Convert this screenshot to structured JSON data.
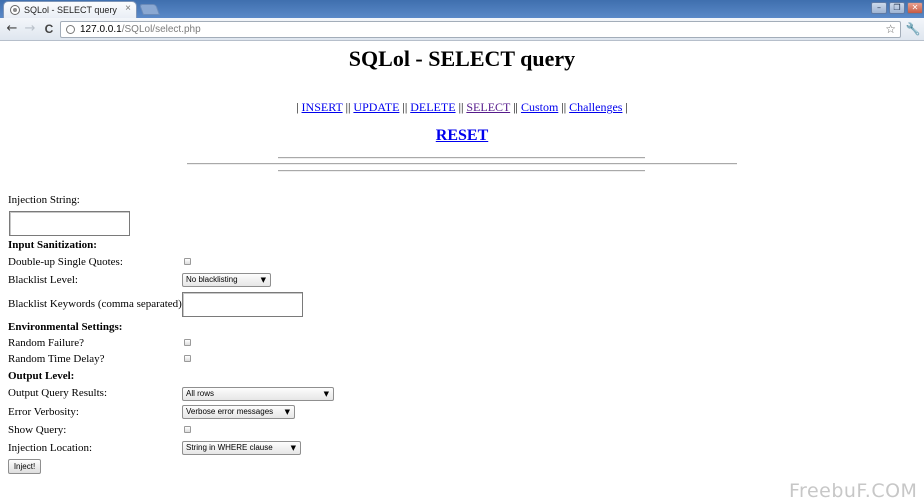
{
  "browser": {
    "tab_title": "SQLol - SELECT query",
    "tab_close_glyph": "×",
    "url_host": "127.0.0.1",
    "url_path": "/SQLol/select.php",
    "back_glyph": "←",
    "forward_glyph": "→",
    "reload_glyph": "C",
    "star_glyph": "☆",
    "wrench_glyph": "🔧",
    "window_controls": {
      "minimize": "–",
      "maximize": "❐",
      "close": "✕"
    }
  },
  "page": {
    "title": "SQLol - SELECT query",
    "nav": {
      "sep_first": "|",
      "sep": "||",
      "sep_last": "|",
      "items": [
        "INSERT",
        "UPDATE",
        "DELETE",
        "SELECT",
        "Custom",
        "Challenges"
      ]
    },
    "reset_label": "RESET"
  },
  "form": {
    "injection_string_label": "Injection String:",
    "injection_string_value": "",
    "input_sanitization_heading": "Input Sanitization:",
    "double_up_quotes_label": "Double-up Single Quotes:",
    "double_up_quotes_checked": false,
    "blacklist_level_label": "Blacklist Level:",
    "blacklist_level_value": "No blacklisting",
    "blacklist_keywords_label": "Blacklist Keywords (comma separated):",
    "blacklist_keywords_value": "",
    "environmental_heading": "Environmental Settings:",
    "random_failure_label": "Random Failure?",
    "random_failure_checked": false,
    "random_delay_label": "Random Time Delay?",
    "random_delay_checked": false,
    "output_level_heading": "Output Level:",
    "output_results_label": "Output Query Results:",
    "output_results_value": "All rows",
    "error_verbosity_label": "Error Verbosity:",
    "error_verbosity_value": "Verbose error messages",
    "show_query_label": "Show Query:",
    "show_query_checked": false,
    "injection_location_label": "Injection Location:",
    "injection_location_value": "String in WHERE clause",
    "select_arrow": "▼",
    "inject_button_label": "Inject!"
  },
  "watermark": "FreebuF.COM"
}
